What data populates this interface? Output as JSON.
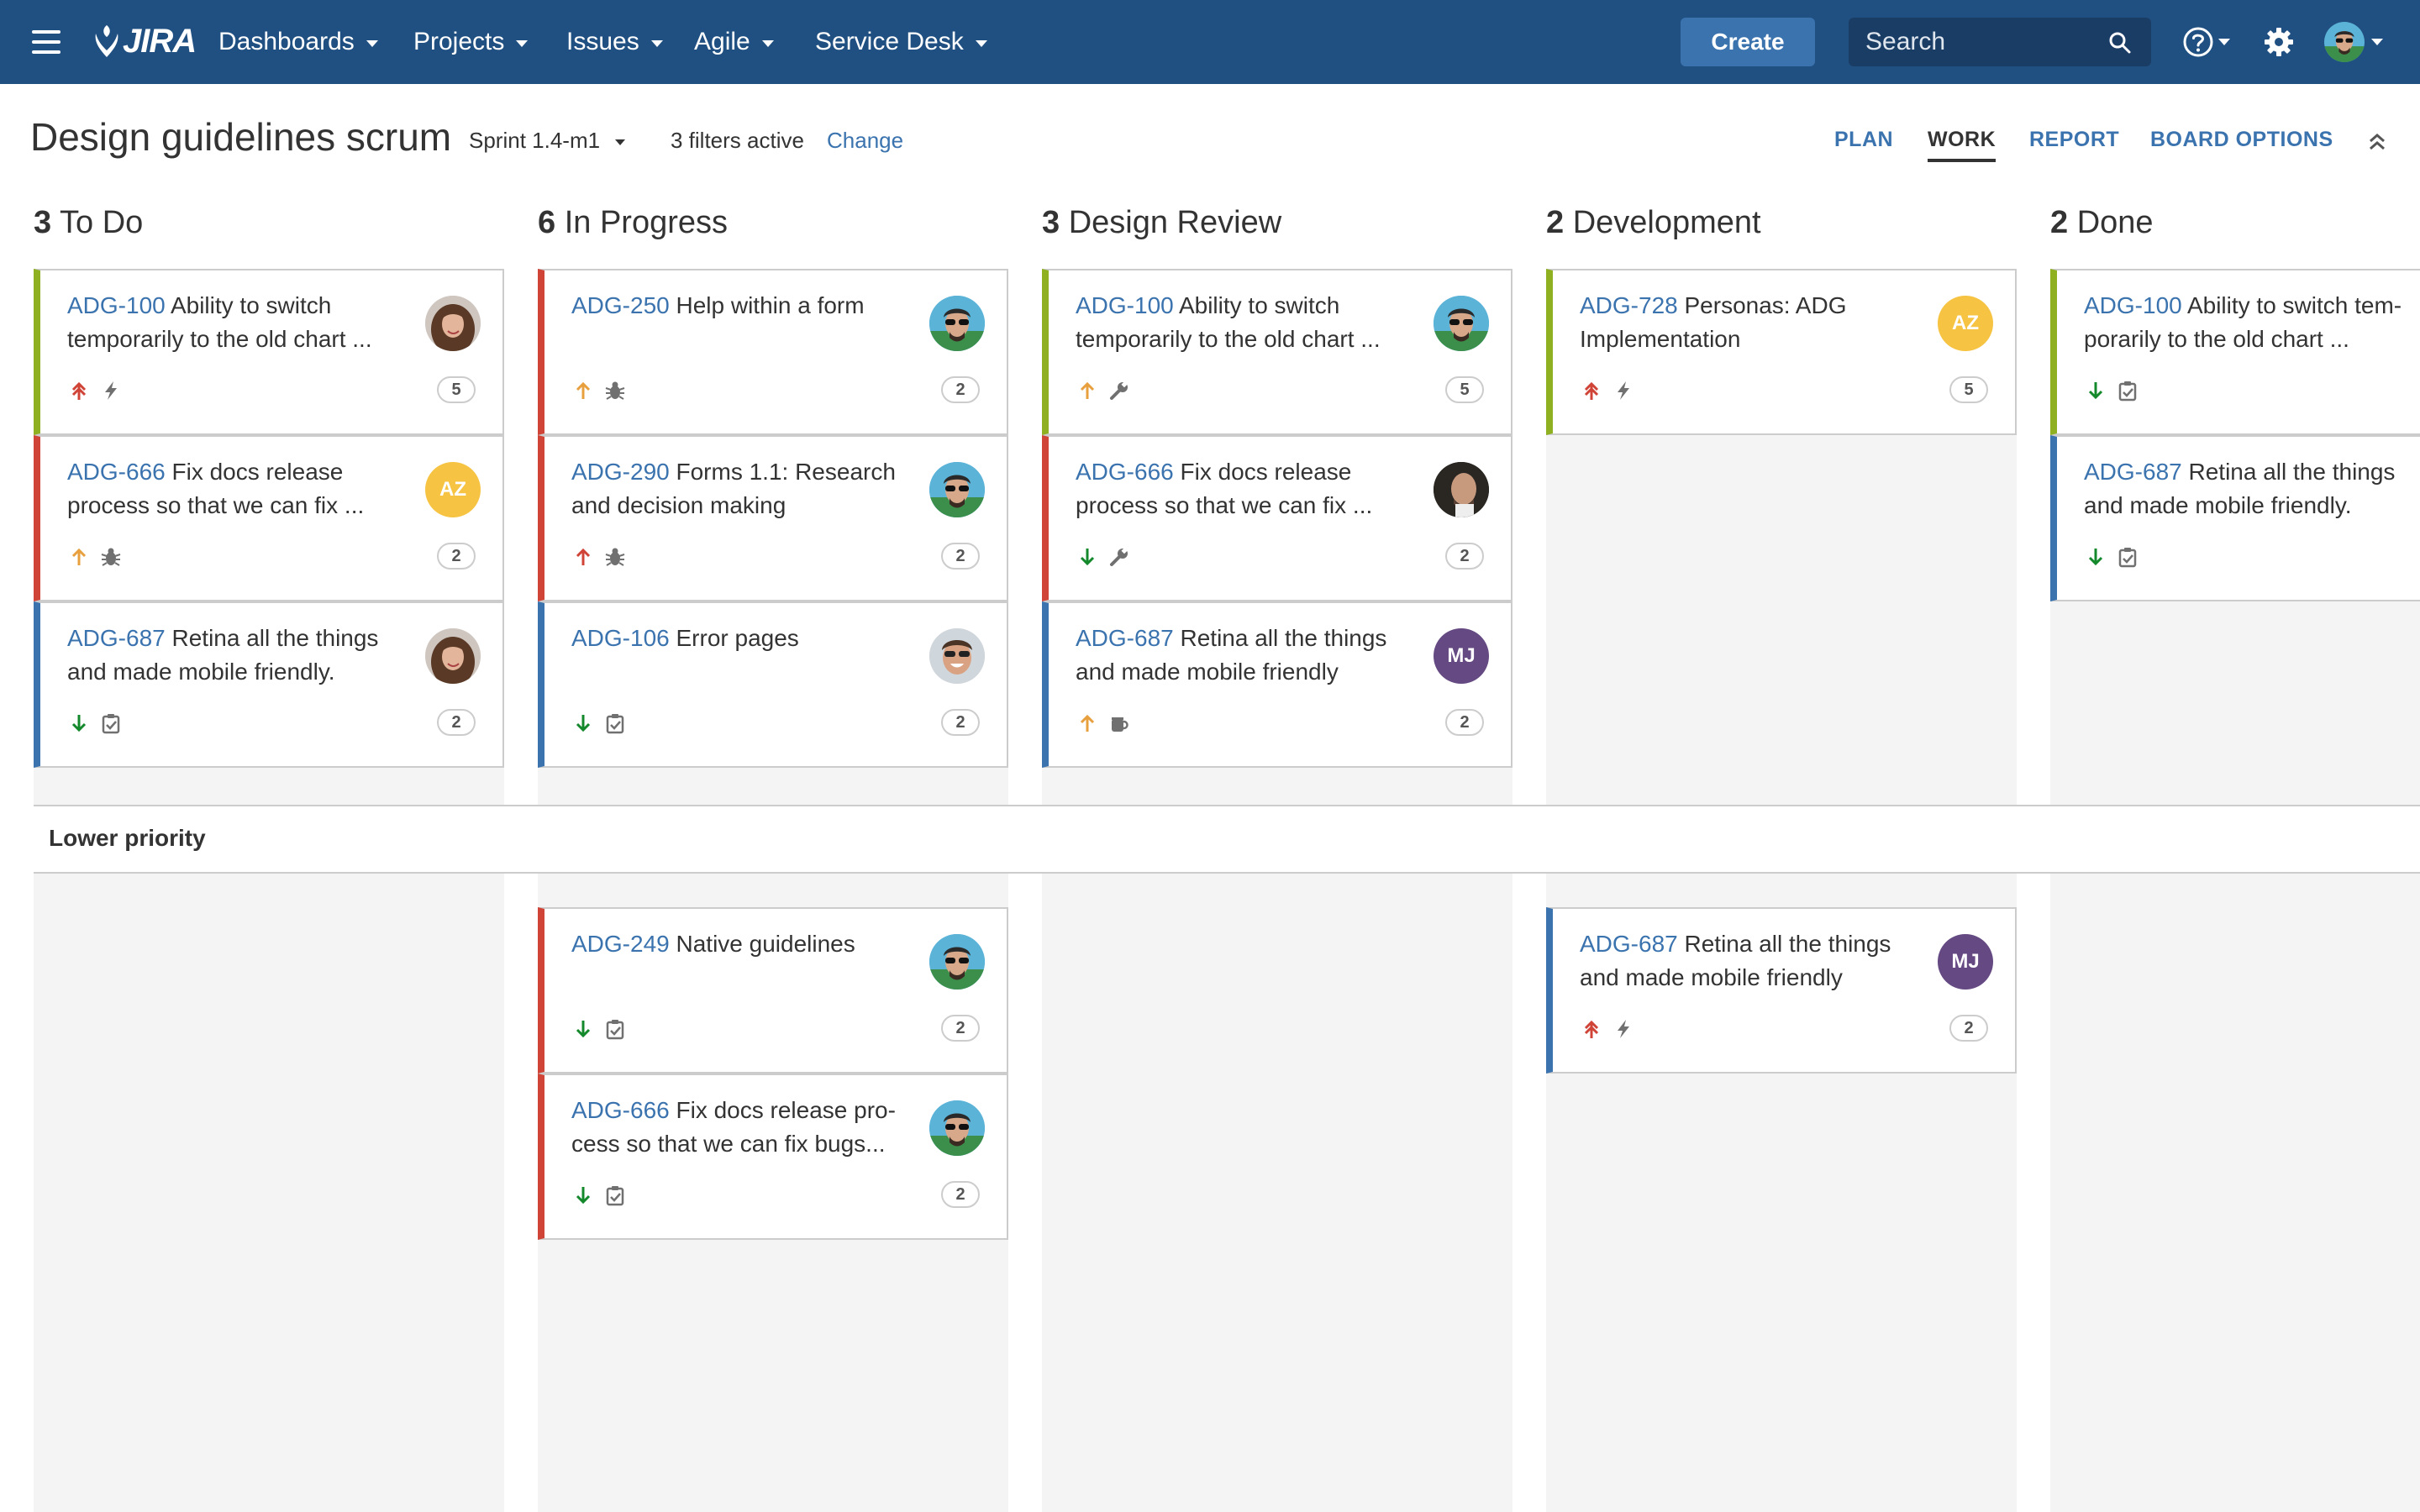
{
  "colors": {
    "header_bg": "#205081",
    "link": "#3b73af",
    "create_button": "#3b73af",
    "column_bg": "#f4f4f4",
    "story": "#8eb021",
    "bug": "#d04437",
    "task": "#3b73af",
    "priority_highest": "#d04437",
    "priority_high": "#e8a03f",
    "priority_low": "#14892c"
  },
  "header": {
    "logo_text": "JIRA",
    "nav": [
      "Dashboards",
      "Projects",
      "Issues",
      "Agile",
      "Service Desk"
    ],
    "create_label": "Create",
    "search_placeholder": "Search"
  },
  "board": {
    "title": "Design guidelines scrum",
    "sprint": "Sprint 1.4-m1",
    "filters": "3 filters active",
    "change": "Change",
    "tabs": [
      "PLAN",
      "WORK",
      "REPORT",
      "BOARD OPTIONS"
    ],
    "active_tab": "WORK"
  },
  "columns": [
    {
      "count": "3",
      "name": "To Do"
    },
    {
      "count": "6",
      "name": "In Progress"
    },
    {
      "count": "3",
      "name": "Design Review"
    },
    {
      "count": "2",
      "name": "Development"
    },
    {
      "count": "2",
      "name": "Done"
    }
  ],
  "swimlane": {
    "label": "Lower priority"
  },
  "cards": [
    {
      "key": "ADG-100",
      "summary": "Ability to switch temporarily to the old chart ...",
      "type": "story",
      "priority": "highest",
      "issue_icon": "lightning-icon",
      "points": "5",
      "assignee": "woman-photo"
    },
    {
      "key": "ADG-666",
      "summary": "Fix docs release process so that we can fix ...",
      "type": "bug",
      "priority": "high",
      "issue_icon": "bug-icon",
      "points": "2",
      "assignee": "AZ"
    },
    {
      "key": "ADG-687",
      "summary": "Retina all the things and made mobile friendly.",
      "type": "task",
      "priority": "low",
      "issue_icon": "task-icon",
      "points": "2",
      "assignee": "woman-photo"
    },
    {
      "key": "ADG-250",
      "summary": "Help within a form",
      "type": "bug",
      "priority": "high",
      "issue_icon": "bug-icon",
      "points": "2",
      "assignee": "man-sunglasses-photo"
    },
    {
      "key": "ADG-290",
      "summary": "Forms 1.1: Research and decision making",
      "type": "bug",
      "priority": "highest-single",
      "issue_icon": "bug-icon",
      "points": "2",
      "assignee": "man-sunglasses-photo"
    },
    {
      "key": "ADG-106",
      "summary": "Error pages",
      "type": "task",
      "priority": "low",
      "issue_icon": "task-icon",
      "points": "2",
      "assignee": "man-smiling-photo"
    },
    {
      "key": "ADG-100",
      "summary": "Ability to switch temporarily to the old chart ...",
      "type": "story",
      "priority": "high",
      "issue_icon": "wrench-icon",
      "points": "5",
      "assignee": "man-sunglasses-photo"
    },
    {
      "key": "ADG-666",
      "summary": "Fix docs release process so that we can fix ...",
      "type": "bug",
      "priority": "low",
      "issue_icon": "wrench-icon",
      "points": "2",
      "assignee": "man-bald-photo"
    },
    {
      "key": "ADG-687",
      "summary": "Retina all the things and made mobile friendly",
      "type": "task",
      "priority": "high",
      "issue_icon": "coffee-icon",
      "points": "2",
      "assignee": "MJ"
    },
    {
      "key": "ADG-728",
      "summary": "Personas: ADG Implementation",
      "type": "story",
      "priority": "highest",
      "issue_icon": "lightning-icon",
      "points": "5",
      "assignee": "AZ"
    },
    {
      "key": "ADG-100",
      "summary": "Ability to switch tem-porarily to the old chart ...",
      "type": "story",
      "priority": "low",
      "issue_icon": "task-icon",
      "points": "",
      "assignee": ""
    },
    {
      "key": "ADG-687",
      "summary": "Retina all the things and made mobile friendly.",
      "type": "task",
      "priority": "low",
      "issue_icon": "task-icon",
      "points": "",
      "assignee": ""
    },
    {
      "key": "ADG-249",
      "summary": "Native guidelines",
      "type": "bug",
      "priority": "low",
      "issue_icon": "task-icon",
      "points": "2",
      "assignee": "man-sunglasses-photo"
    },
    {
      "key": "ADG-666",
      "summary": "Fix docs release pro-cess so that we can fix bugs...",
      "type": "bug",
      "priority": "low",
      "issue_icon": "task-icon",
      "points": "2",
      "assignee": "man-sunglasses-photo"
    },
    {
      "key": "ADG-687",
      "summary": "Retina all the things and made mobile friendly",
      "type": "task",
      "priority": "highest",
      "issue_icon": "lightning-icon",
      "points": "2",
      "assignee": "MJ"
    }
  ]
}
